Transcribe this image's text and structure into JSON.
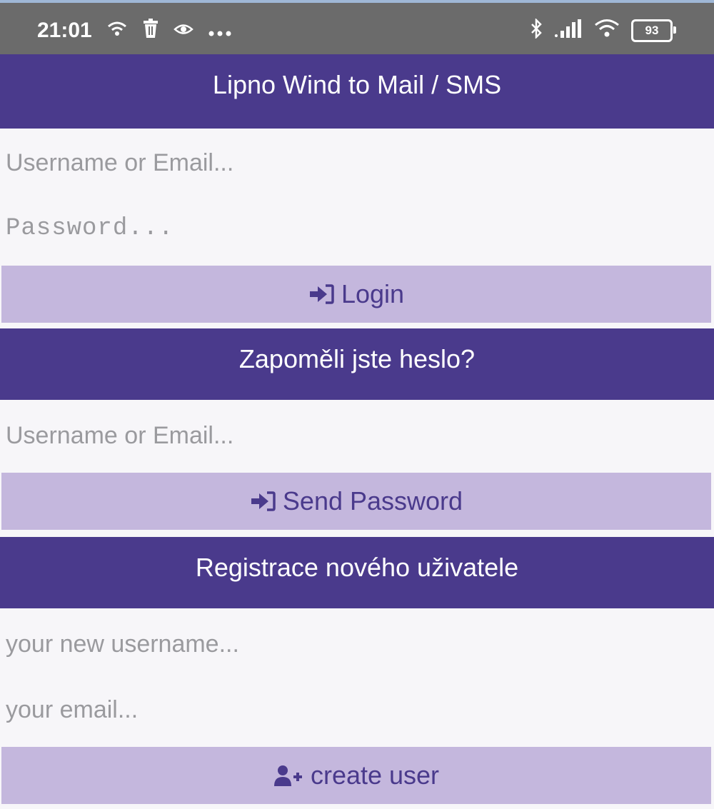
{
  "status_bar": {
    "time": "21:01",
    "left_icons": [
      "wifi-calling-icon",
      "trash-icon",
      "eye-icon",
      "more-dots-icon"
    ],
    "right_icons": [
      "bluetooth-icon",
      "signal-icon",
      "wifi-icon"
    ],
    "battery_level": "93"
  },
  "header": {
    "title": "Lipno Wind to Mail / SMS"
  },
  "login": {
    "username_placeholder": "Username or Email...",
    "password_placeholder": "Password...",
    "login_label": "Login",
    "login_icon": "sign-in-icon"
  },
  "forgot": {
    "title": "Zapoměli jste heslo?",
    "username_placeholder": "Username or Email...",
    "send_label": "Send Password",
    "send_icon": "sign-in-icon"
  },
  "register": {
    "title": "Registrace nového uživatele",
    "username_placeholder": "your new username...",
    "email_placeholder": "your email...",
    "create_label": "create user",
    "create_icon": "user-plus-icon"
  },
  "colors": {
    "header_purple": "#4a3a8c",
    "button_lavender": "#c4b7dd",
    "status_bar_gray": "#6b6b6b"
  }
}
